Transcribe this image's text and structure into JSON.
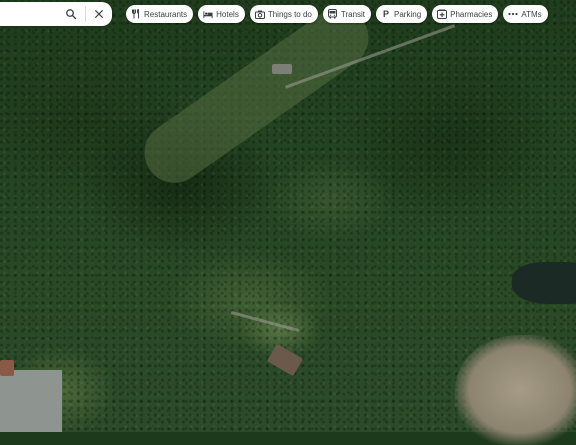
{
  "search": {
    "value": "",
    "placeholder": "",
    "search_icon": "search-icon",
    "close_icon": "close-icon"
  },
  "chips": [
    {
      "label": "Restaurants",
      "icon": "utensils-icon"
    },
    {
      "label": "Hotels",
      "icon": "bed-icon"
    },
    {
      "label": "Things to do",
      "icon": "camera-icon"
    },
    {
      "label": "Transit",
      "icon": "bus-icon"
    },
    {
      "label": "Parking",
      "icon": "parking-icon"
    },
    {
      "label": "Pharmacies",
      "icon": "pharmacy-icon"
    },
    {
      "label": "ATMs",
      "icon": "dots-icon"
    }
  ],
  "map": {
    "view": "satellite"
  }
}
